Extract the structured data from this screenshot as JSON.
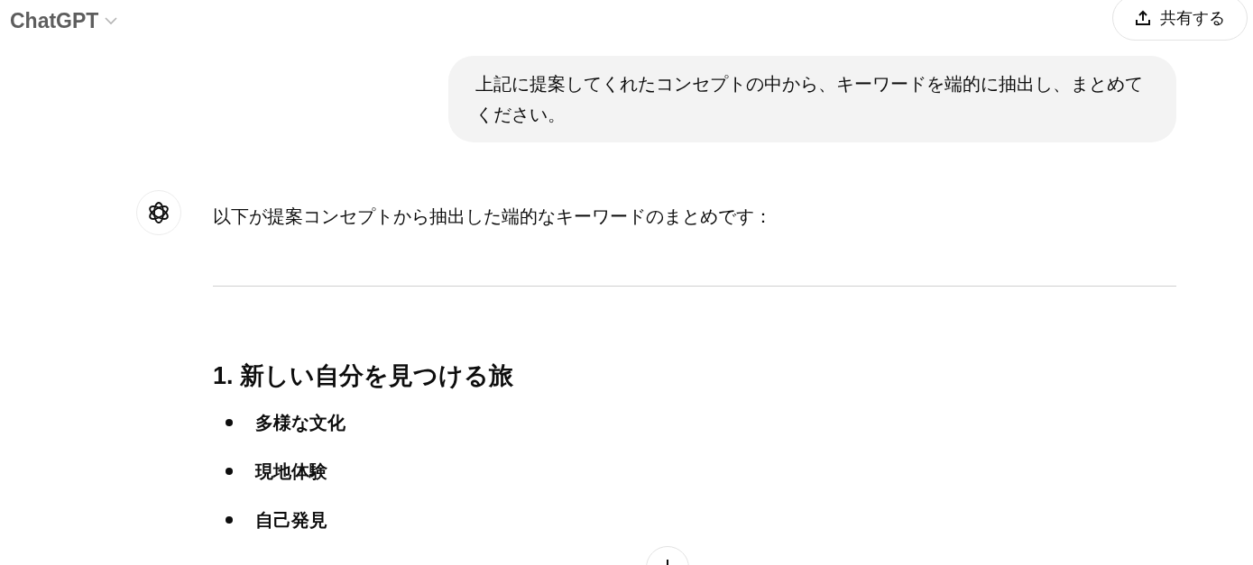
{
  "header": {
    "title": "ChatGPT",
    "share_button": "共有する"
  },
  "user_message": "上記に提案してくれたコンセプトの中から、キーワードを端的に抽出し、まとめてください。",
  "assistant_message": {
    "intro": "以下が提案コンセプトから抽出した端的なキーワードのまとめです：",
    "sections": [
      {
        "heading": "1. 新しい自分を見つける旅",
        "items": [
          "多様な文化",
          "現地体験",
          "自己発見"
        ]
      }
    ]
  }
}
